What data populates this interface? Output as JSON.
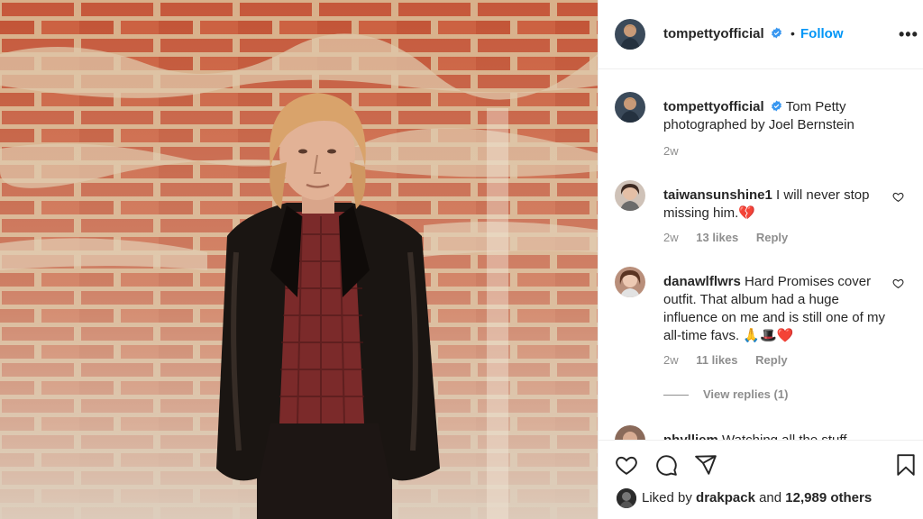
{
  "post": {
    "username": "tompettyofficial",
    "follow_label": "Follow",
    "dot": "•",
    "more_label": "•••"
  },
  "caption": {
    "username": "tompettyofficial",
    "text": "Tom Petty photographed by Joel Bernstein",
    "time": "2w"
  },
  "comments": [
    {
      "username": "taiwansunshine1",
      "text": "I will never stop missing him.💔",
      "time": "2w",
      "likes": "13 likes",
      "reply": "Reply"
    },
    {
      "username": "danawlflwrs",
      "text": "Hard Promises cover outfit. That album had a huge influence on me and is still one of my all-time favs. 🙏🎩❤️",
      "time": "2w",
      "likes": "11 likes",
      "reply": "Reply"
    },
    {
      "username": "phylliem",
      "text": "Watching all the stuff"
    }
  ],
  "view_replies": "View replies (1)",
  "likes_line": {
    "prefix": "Liked by",
    "user": "drakpack",
    "conj": "and",
    "count": "12,989 others"
  },
  "colors": {
    "accent": "#0095f6",
    "verified": "#3897f0",
    "text": "#262626",
    "muted": "#8e8e8e",
    "heart_red": "#ed4956"
  },
  "icons": [
    "verified-badge-icon",
    "more-options-icon",
    "heart-icon",
    "comment-icon",
    "share-icon",
    "bookmark-icon"
  ]
}
